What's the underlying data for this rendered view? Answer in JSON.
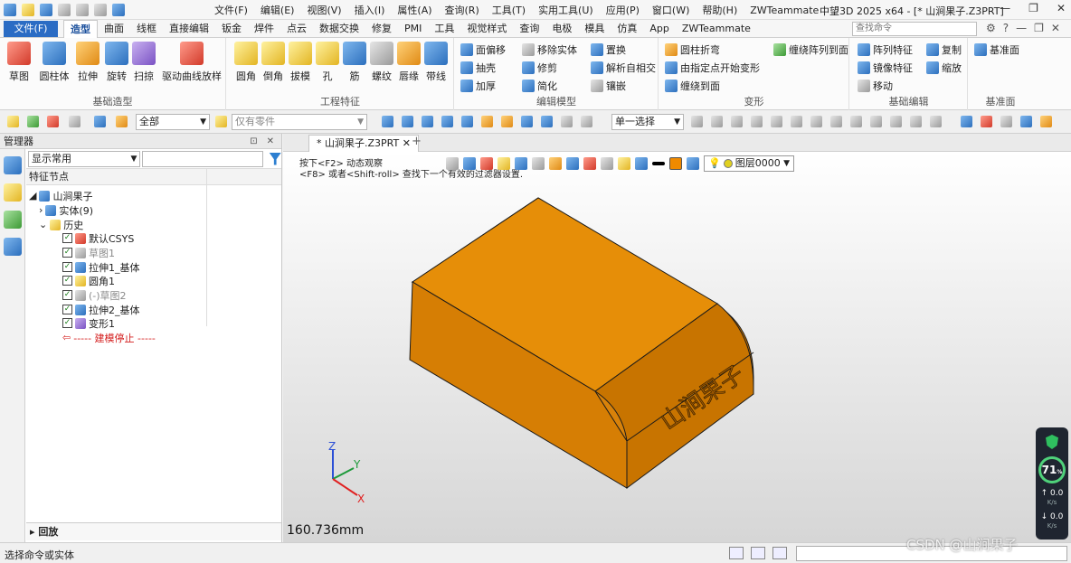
{
  "titlebar": {
    "menu": [
      "文件(F)",
      "编辑(E)",
      "视图(V)",
      "插入(I)",
      "属性(A)",
      "查询(R)",
      "工具(T)",
      "实用工具(U)",
      "应用(P)",
      "窗口(W)",
      "帮助(H)",
      "ZWTeammate"
    ],
    "window_title": "中望3D 2025 x64 - [* 山涧果子.Z3PRT]"
  },
  "ribbon_tabs": {
    "file_button": "文件(F)",
    "tabs": [
      "造型",
      "曲面",
      "线框",
      "直接编辑",
      "钣金",
      "焊件",
      "点云",
      "数据交换",
      "修复",
      "PMI",
      "工具",
      "视觉样式",
      "查询",
      "电极",
      "模具",
      "仿真",
      "App",
      "ZWTeammate"
    ],
    "active": "造型",
    "search_placeholder": "查找命令"
  },
  "ribbon": {
    "basic_shapes": {
      "label": "基础造型",
      "buttons": [
        "草图",
        "圆柱体",
        "拉伸",
        "旋转",
        "扫掠",
        "驱动曲线放样"
      ]
    },
    "engineering": {
      "label": "工程特征",
      "buttons": [
        "圆角",
        "倒角",
        "拔模",
        "孔",
        "筋",
        "螺纹",
        "唇缘",
        "带线"
      ]
    },
    "edit_model": {
      "label": "编辑模型",
      "items": [
        "面偏移",
        "移除实体",
        "置换",
        "抽壳",
        "修剪",
        "解析自相交",
        "加厚",
        "简化",
        "镶嵌"
      ]
    },
    "deform": {
      "label": "变形",
      "items": [
        "圆柱折弯",
        "缠绕阵列到面",
        "由指定点开始变形",
        "缠绕到面"
      ]
    },
    "basic_edit": {
      "label": "基础编辑",
      "items": [
        "阵列特征",
        "复制",
        "镜像特征",
        "缩放",
        "移动"
      ]
    },
    "datum": {
      "label": "基准面",
      "items": [
        "基准面"
      ]
    }
  },
  "toolbar2": {
    "filter_all": "全部",
    "part_only": "仅有零件",
    "single_select": "单一选择"
  },
  "manager": {
    "title": "管理器",
    "display_filter": "显示常用",
    "column_header": "特征节点",
    "tree": [
      {
        "label": "山涧果子",
        "depth": 0
      },
      {
        "label": "实体(9)",
        "depth": 1
      },
      {
        "label": "历史",
        "depth": 1
      },
      {
        "label": "默认CSYS",
        "depth": 2
      },
      {
        "label": "草图1",
        "depth": 2
      },
      {
        "label": "拉伸1_基体",
        "depth": 2
      },
      {
        "label": "圆角1",
        "depth": 2
      },
      {
        "label": "(-)草图2",
        "depth": 2
      },
      {
        "label": "拉伸2_基体",
        "depth": 2
      },
      {
        "label": "变形1",
        "depth": 2
      },
      {
        "label": "----- 建模停止 -----",
        "depth": 2
      }
    ],
    "playback": "回放"
  },
  "document": {
    "tab": "* 山涧果子.Z3PRT",
    "hint_line1": "按下<F2> 动态观察",
    "hint_line2": "<F8> 或者<Shift-roll> 查找下一个有效的过滤器设置.",
    "layer": "图层0000",
    "distance": "160.736mm",
    "engraving_text": "山涧果子",
    "axes": {
      "x": "X",
      "y": "Y",
      "z": "Z"
    },
    "colors": {
      "body_top": "#e38a06",
      "body_front": "#d47c00",
      "body_side": "#c06f00",
      "edge": "#1a1a1a"
    }
  },
  "status": {
    "message": "选择命令或实体"
  },
  "perf_widget": {
    "percent": "71",
    "up_speed": "0.0",
    "down_speed": "0.0",
    "unit": "K/s"
  },
  "watermark": "CSDN @山涧果子"
}
